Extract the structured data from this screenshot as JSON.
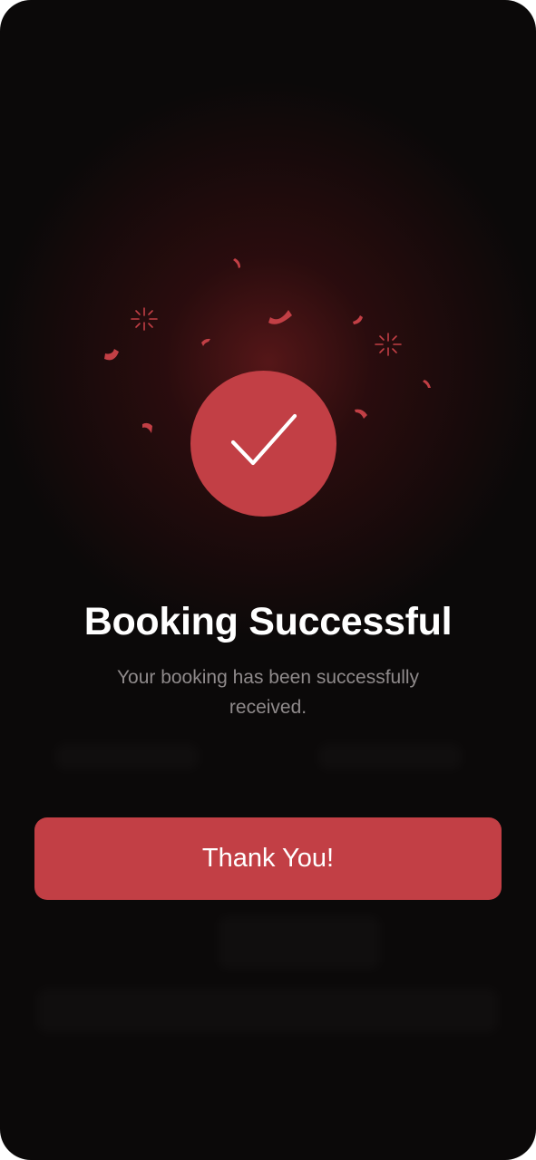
{
  "dialog": {
    "title": "Booking Successful",
    "message": "Your booking has been successfully received.",
    "button_label": "Thank You!"
  },
  "icons": {
    "status": "checkmark-icon",
    "decoration": "confetti"
  },
  "colors": {
    "accent": "#c23f45",
    "background": "#0b0909",
    "glow": "#5f181a",
    "title_text": "#ffffff",
    "message_text": "#8f8a8b"
  }
}
